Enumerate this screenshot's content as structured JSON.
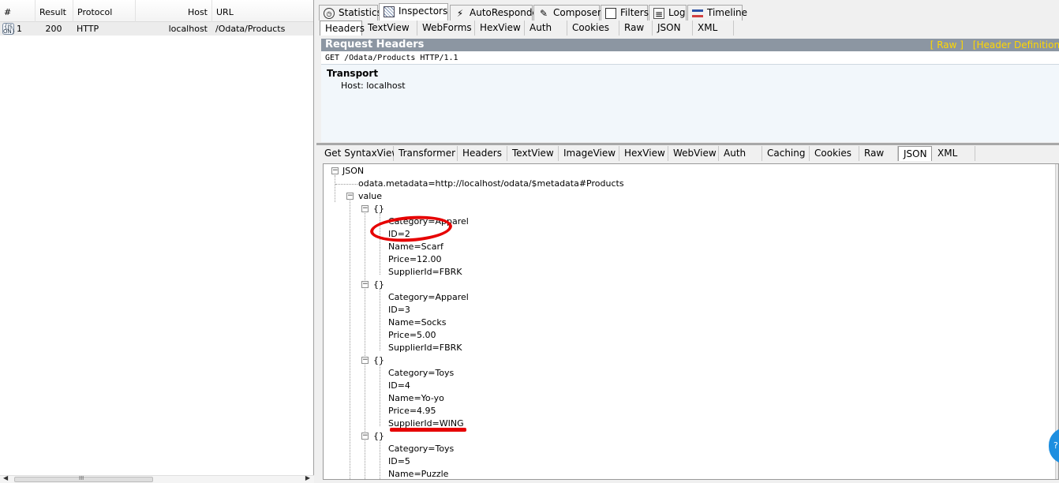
{
  "sessions": {
    "columns": {
      "num": "#",
      "result": "Result",
      "protocol": "Protocol",
      "host": "Host",
      "url": "URL"
    },
    "rows": [
      {
        "icon_text": "{JS\nON}",
        "num": "1",
        "result": "200",
        "protocol": "HTTP",
        "host": "localhost",
        "url": "/Odata/Products"
      }
    ],
    "scroll_grip": "III"
  },
  "main_tabs": [
    {
      "label": "Statistics",
      "icon": "stopwatch-icon"
    },
    {
      "label": "Inspectors",
      "icon": "inspectors-icon"
    },
    {
      "label": "AutoResponder",
      "icon": "lightning-icon"
    },
    {
      "label": "Composer",
      "icon": "composer-icon"
    },
    {
      "label": "Filters",
      "icon": "checkbox-icon"
    },
    {
      "label": "Log",
      "icon": "log-icon"
    },
    {
      "label": "Timeline",
      "icon": "timeline-icon"
    }
  ],
  "request_tabs": [
    "Headers",
    "TextView",
    "WebForms",
    "HexView",
    "Auth",
    "Cookies",
    "Raw",
    "JSON",
    "XML"
  ],
  "request_headers": {
    "title": "Request Headers",
    "links": [
      "[ Raw ]",
      "[Header Definitions]"
    ],
    "request_line": "GET /Odata/Products HTTP/1.1",
    "group_title": "Transport",
    "host_line": "Host: localhost"
  },
  "response_tabs": [
    "Get SyntaxView",
    "Transformer",
    "Headers",
    "TextView",
    "ImageView",
    "HexView",
    "WebView",
    "Auth",
    "Caching",
    "Cookies",
    "Raw",
    "JSON",
    "XML"
  ],
  "json_tree": {
    "root": "JSON",
    "metadata": "odata.metadata=http://localhost/odata/$metadata#Products",
    "value_label": "value",
    "object_label": "{}",
    "items": [
      {
        "category": "Category=Apparel",
        "id": "ID=2",
        "name": "Name=Scarf",
        "price": "Price=12.00",
        "supplier": "SupplierId=FBRK"
      },
      {
        "category": "Category=Apparel",
        "id": "ID=3",
        "name": "Name=Socks",
        "price": "Price=5.00",
        "supplier": "SupplierId=FBRK"
      },
      {
        "category": "Category=Toys",
        "id": "ID=4",
        "name": "Name=Yo-yo",
        "price": "Price=4.95",
        "supplier": "SupplierId=WING"
      },
      {
        "category": "Category=Toys",
        "id": "ID=5",
        "name": "Name=Puzzle"
      }
    ]
  },
  "colors": {
    "annotation_red": "#e60000",
    "headers_bar": "#8c96a2",
    "headers_link": "#ffd700"
  }
}
